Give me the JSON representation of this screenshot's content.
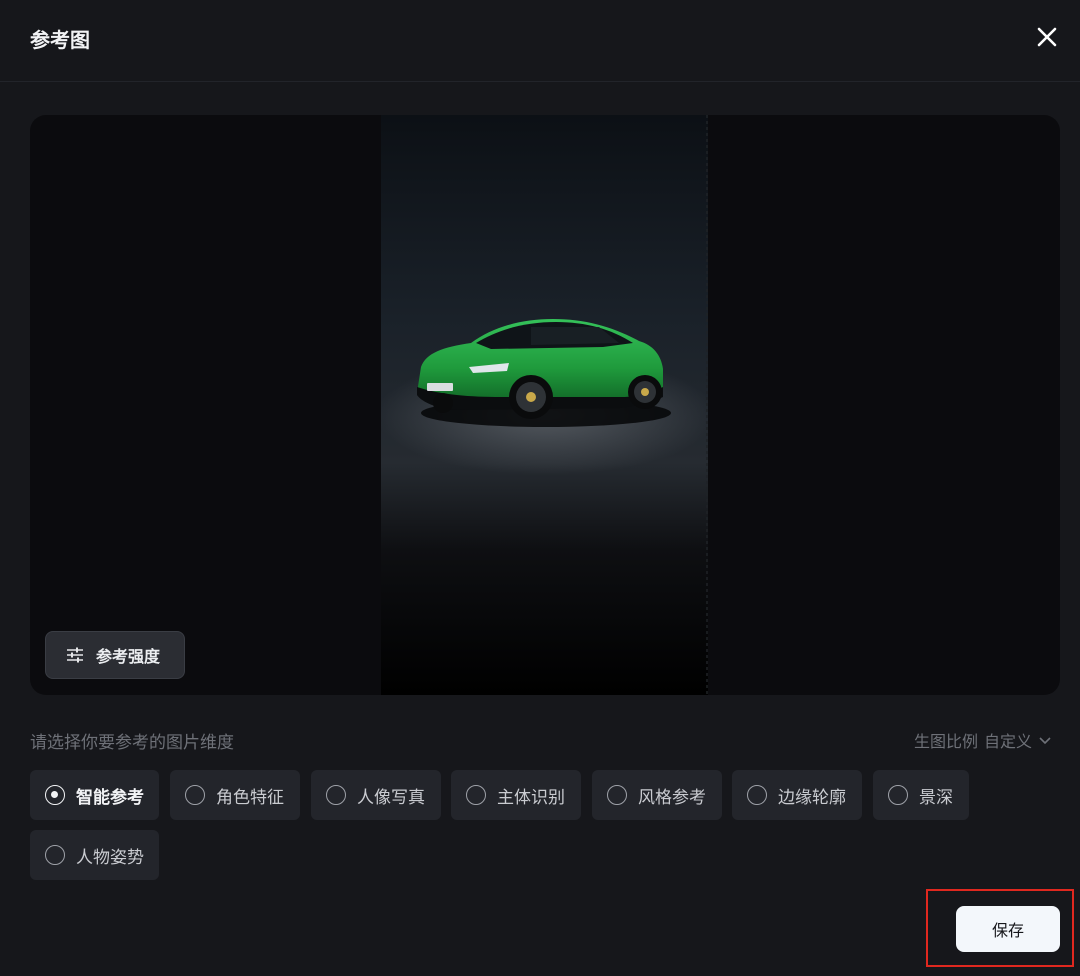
{
  "dialog": {
    "title": "参考图"
  },
  "preview": {
    "strength_button_label": "参考强度"
  },
  "dimension_prompt": "请选择你要参考的图片维度",
  "ratio": {
    "label": "生图比例",
    "value": "自定义"
  },
  "options": [
    {
      "label": "智能参考",
      "selected": true
    },
    {
      "label": "角色特征",
      "selected": false
    },
    {
      "label": "人像写真",
      "selected": false
    },
    {
      "label": "主体识别",
      "selected": false
    },
    {
      "label": "风格参考",
      "selected": false
    },
    {
      "label": "边缘轮廓",
      "selected": false
    },
    {
      "label": "景深",
      "selected": false
    },
    {
      "label": "人物姿势",
      "selected": false
    }
  ],
  "footer": {
    "save_label": "保存"
  },
  "icons": {
    "close": "close-icon",
    "strength": "sliders-icon",
    "ratio_dropdown": "chevron-down-icon"
  },
  "colors": {
    "background": "#16171b",
    "option_bg": "#23252b",
    "save_bg": "#f3f7fb",
    "car_green": "#1f9a3c",
    "highlight_border": "#e0281f"
  }
}
